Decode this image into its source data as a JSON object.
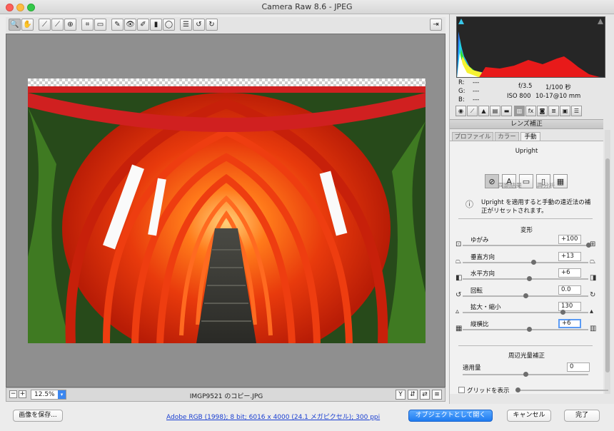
{
  "window": {
    "title": "Camera Raw 8.6 - JPEG"
  },
  "toolbar": {
    "tools": [
      "zoom-icon",
      "hand-icon",
      "white-balance-icon",
      "color-sampler-icon",
      "target-adjust-icon",
      "crop-icon",
      "straighten-icon",
      "spot-removal-icon",
      "red-eye-icon",
      "adjustment-brush-icon",
      "graduated-filter-icon",
      "radial-filter-icon",
      "preferences-icon",
      "rotate-ccw-icon",
      "rotate-cw-icon"
    ],
    "fullscreen_icon": "fullscreen-icon"
  },
  "status": {
    "zoom": "12.5%",
    "filename": "IMGP9521 のコピー.JPG"
  },
  "bottom": {
    "save_label": "画像を保存...",
    "workflow_link": "Adobe RGB (1998); 8 bit; 6016 x 4000 (24.1 メガピクセル); 300 ppi",
    "open_object_label": "オブジェクトとして開く",
    "cancel_label": "キャンセル",
    "done_label": "完了"
  },
  "info": {
    "r_label": "R:",
    "g_label": "G:",
    "b_label": "B:",
    "r_val": "---",
    "g_val": "---",
    "b_val": "---",
    "aperture": "f/3.5",
    "shutter": "1/100 秒",
    "iso": "ISO 800",
    "lens": "10-17@10 mm"
  },
  "panel": {
    "title": "レンズ補正",
    "tabs": [
      "プロファイル",
      "カラー",
      "手動"
    ],
    "upright_heading": "Upright",
    "upright_buttons": [
      "⊘",
      "A",
      "▭",
      "▯",
      "▦"
    ],
    "reanalyze": "同期結果",
    "analyze": "再分析",
    "info_text_1": "Upright を適用すると手動の遠近法の補",
    "info_text_2": "正がリセットされます。",
    "transform_heading": "変形",
    "sliders": [
      {
        "label": "ゆがみ",
        "value": "+100",
        "pos": 1.0
      },
      {
        "label": "垂直方向",
        "value": "+13",
        "pos": 0.565
      },
      {
        "label": "水平方向",
        "value": "+6",
        "pos": 0.53
      },
      {
        "label": "回転",
        "value": "0.0",
        "pos": 0.5
      },
      {
        "label": "拡大・縮小",
        "value": "130",
        "pos": 0.8
      },
      {
        "label": "縦横比",
        "value": "+6",
        "pos": 0.53
      }
    ],
    "vignette_heading": "周辺光量補正",
    "vignette_amount_label": "適用量",
    "vignette_amount_value": "0",
    "vignette_pos": 0.5,
    "grid_label": "グリッドを表示"
  }
}
